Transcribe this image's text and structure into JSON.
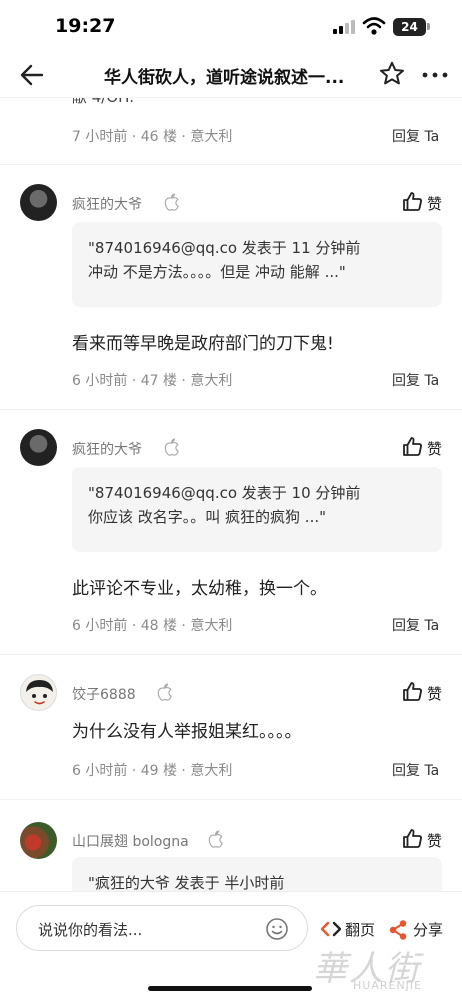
{
  "status_bar": {
    "time": "19:27",
    "battery": "24"
  },
  "nav": {
    "title": "华人街砍人，道听途说叙述一..."
  },
  "partial_top_text": "献 4/OH.",
  "comments": [
    {
      "meta": "7 小时前 · 46 楼 · 意大利",
      "reply": "回复 Ta"
    },
    {
      "username": "疯狂的大爷",
      "like": "赞",
      "quote_line1": "\"874016946@qq.co 发表于 11 分钟前",
      "quote_line2": "冲动 不是方法。。。。但是 冲动 能解 ...\"",
      "text": "看来而等早晚是政府部门的刀下鬼!",
      "meta": "6 小时前 · 47 楼 · 意大利",
      "reply": "回复 Ta"
    },
    {
      "username": "疯狂的大爷",
      "like": "赞",
      "quote_line1": "\"874016946@qq.co 发表于 10 分钟前",
      "quote_line2": "你应该 改名字。。叫 疯狂的疯狗 ...\"",
      "text": "此评论不专业，太幼稚，换一个。",
      "meta": "6 小时前 · 48 楼 · 意大利",
      "reply": "回复 Ta"
    },
    {
      "username": "饺子6888",
      "like": "赞",
      "text": "为什么没有人举报姐某红。。。。",
      "meta": "6 小时前 · 49 楼 · 意大利",
      "reply": "回复 Ta"
    },
    {
      "username": "山口展翅 bologna",
      "like": "赞",
      "quote_line1": "\"疯狂的大爷 发表于 半小时前"
    }
  ],
  "bottom_bar": {
    "input_placeholder": "说说你的看法...",
    "page_turn": "翻页",
    "share": "分享"
  },
  "watermark": {
    "main": "華人街",
    "sub": "HUARENJIE"
  },
  "colors": {
    "text_primary": "#222222",
    "meta_gray": "#8a8a8a",
    "share_accent": "#e8542e",
    "quote_bg": "#f5f5f5"
  },
  "icons": [
    "back-arrow-icon",
    "star-icon",
    "more-icon",
    "apple-icon",
    "thumb-up-icon",
    "emoji-icon",
    "code-icon",
    "share-icon"
  ]
}
